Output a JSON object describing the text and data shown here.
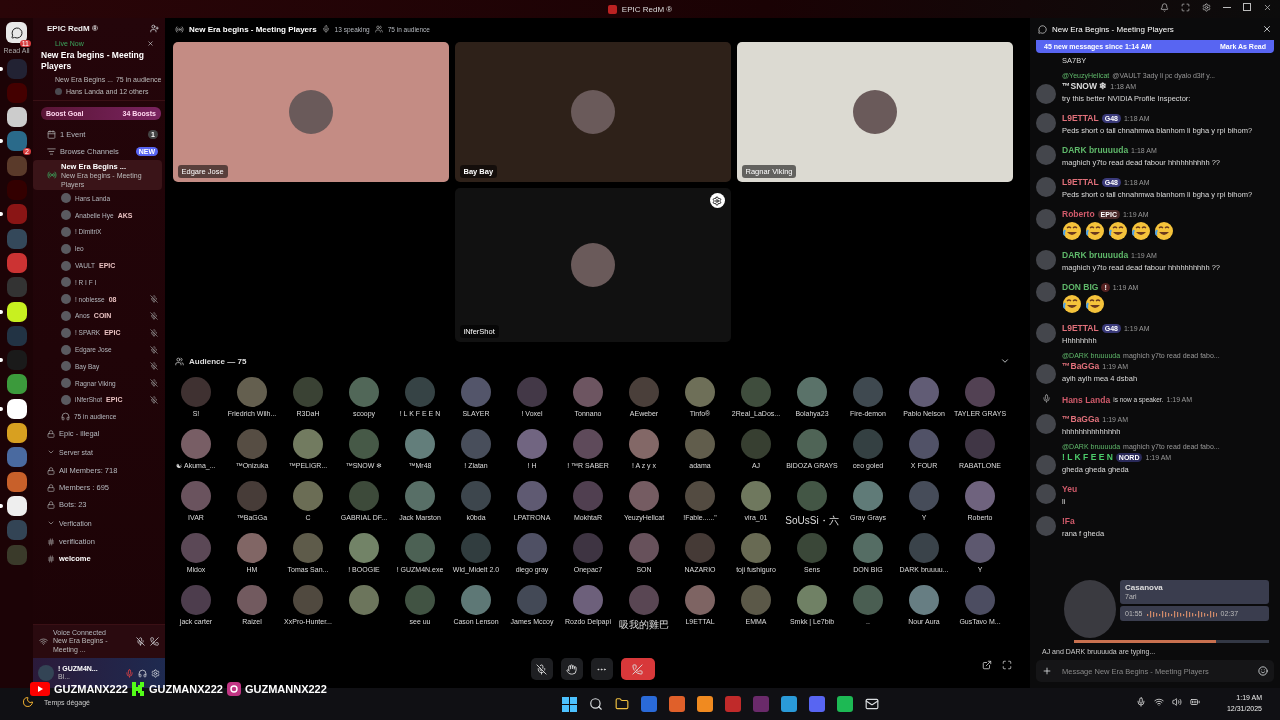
{
  "titlebar": {
    "title": "EPIC RedM ®"
  },
  "server_rail": {
    "read_all": "Read All",
    "badge": "11",
    "servers": [
      {
        "unread": true
      },
      {
        "unread": false
      },
      {
        "unread": false
      },
      {
        "unread": true,
        "badge": "2"
      },
      {
        "unread": false
      },
      {
        "unread": false
      },
      {
        "unread": true
      },
      {
        "unread": false
      },
      {
        "unread": false
      },
      {
        "unread": false
      },
      {
        "unread": true
      },
      {
        "unread": false
      },
      {
        "unread": true
      },
      {
        "unread": false
      },
      {
        "unread": true
      },
      {
        "unread": false
      },
      {
        "unread": false
      },
      {
        "unread": false
      },
      {
        "unread": true
      },
      {
        "unread": false
      },
      {
        "unread": false
      }
    ]
  },
  "sidebar": {
    "server_name": "EPIC RedM ®",
    "live": {
      "label": "Live Now",
      "title": "New Era begins - Meeting Players",
      "channel": "New Era Begins ...",
      "audience": "75 in audience",
      "listeners": "Hans Landa and 12 others"
    },
    "boost": {
      "label": "Boost Goal",
      "count": "34 Boosts"
    },
    "event": {
      "label": "1 Event",
      "count": "1"
    },
    "browse": {
      "label": "Browse Channels",
      "badge": "NEW"
    },
    "stage_channel": {
      "name": "New Era Begins ...",
      "subtitle": "New Era begins - Meeting Players",
      "selected": true
    },
    "speakers": [
      {
        "name": "Hans Landa",
        "muted": false
      },
      {
        "name": "Anabelle Hye",
        "tag": "AKS",
        "muted": false
      },
      {
        "name": "! DimitriX",
        "muted": false
      },
      {
        "name": "leo",
        "muted": false
      },
      {
        "name": "VAULT",
        "tag": "EPIC",
        "muted": false
      },
      {
        "name": "! R I F I",
        "muted": false
      },
      {
        "name": "! noblesse",
        "tag": "08",
        "muted": true
      },
      {
        "name": "Anos",
        "tag": "COIN",
        "muted": true
      },
      {
        "name": "! SPARK",
        "tag": "EPIC",
        "muted": true
      },
      {
        "name": "Edgare Jose",
        "muted": true
      },
      {
        "name": "Bay Bay",
        "muted": true
      },
      {
        "name": "Ragnar Viking",
        "muted": true
      },
      {
        "name": "iNferShot",
        "tag": "EPIC",
        "muted": true
      }
    ],
    "audience": "75 in audience",
    "channels": [
      {
        "kind": "locked",
        "name": "Epic - illegal"
      },
      {
        "kind": "category",
        "name": "Server stat"
      },
      {
        "kind": "locked",
        "name": "All Members: 718"
      },
      {
        "kind": "locked",
        "name": "Members : 695"
      },
      {
        "kind": "locked",
        "name": "Bots: 23"
      },
      {
        "kind": "category",
        "name": "Verfication"
      },
      {
        "kind": "text",
        "name": "verification",
        "selected": false
      },
      {
        "kind": "text",
        "name": "welcome",
        "selected": true
      }
    ],
    "voice": {
      "status": "Voice Connected",
      "channel": "New Era Begins - Meeting ..."
    },
    "user": {
      "name": "! GUZM4N...",
      "status": "Bl..."
    }
  },
  "stage": {
    "title": "New Era begins - Meeting Players",
    "speaking": "13 speaking",
    "audience": "75 in audience",
    "tiles": [
      {
        "name": "Edgare Jose",
        "color": "#c48c84"
      },
      {
        "name": "Bay Bay",
        "color": "#2e2119"
      },
      {
        "name": "Ragnar Viking",
        "color": "#dcdad2"
      },
      {
        "name": "iNferShot",
        "color": "#111111",
        "settings": true
      }
    ],
    "audience_title": "Audience — 75",
    "members": [
      {
        "name": "S!"
      },
      {
        "name": "Friedrich Wilh..."
      },
      {
        "name": "R3DaH"
      },
      {
        "name": "scoopy"
      },
      {
        "name": "! L K F E E N"
      },
      {
        "name": "SLAYER"
      },
      {
        "name": "! Voxel"
      },
      {
        "name": "Tonnano"
      },
      {
        "name": "AEweber"
      },
      {
        "name": "Tinfo®"
      },
      {
        "name": "2Real_LaDos..."
      },
      {
        "name": "Bolahya23"
      },
      {
        "name": "Fire-demon"
      },
      {
        "name": "Pablo Nelson"
      },
      {
        "name": "TAYLER GRAYS"
      },
      {
        "name": "☯ Akuma_..."
      },
      {
        "name": "™Onizuka"
      },
      {
        "name": "™PELIGR..."
      },
      {
        "name": "™SNOW ❄"
      },
      {
        "name": "™Mr48"
      },
      {
        "name": "! Zlatan"
      },
      {
        "name": "! H"
      },
      {
        "name": "! ™R SABER"
      },
      {
        "name": "! A z y x"
      },
      {
        "name": "adama"
      },
      {
        "name": "AJ"
      },
      {
        "name": "BIDOZA GRAYS"
      },
      {
        "name": "ceo goled"
      },
      {
        "name": "X FOUR"
      },
      {
        "name": "RABATLONE"
      },
      {
        "name": "IVAR"
      },
      {
        "name": "™BaGGa"
      },
      {
        "name": "C"
      },
      {
        "name": "GABRIAL DF..."
      },
      {
        "name": "Jack Marston"
      },
      {
        "name": "k0bda"
      },
      {
        "name": "LPATRONA"
      },
      {
        "name": "MokhtaR"
      },
      {
        "name": "YeuzyHellcat"
      },
      {
        "name": "!Fable......\""
      },
      {
        "name": "vira_01"
      },
      {
        "name": "SoUsSi・六"
      },
      {
        "name": "Gray Grays"
      },
      {
        "name": "Y"
      },
      {
        "name": "Roberto"
      },
      {
        "name": "Midox"
      },
      {
        "name": "HM"
      },
      {
        "name": "Tomas San..."
      },
      {
        "name": "! BOOGIE"
      },
      {
        "name": "! GUZM4N.exe"
      },
      {
        "name": "Wld_Midelt 2.0"
      },
      {
        "name": "diego gray"
      },
      {
        "name": "Onepac7"
      },
      {
        "name": "SON"
      },
      {
        "name": "NAZARIO"
      },
      {
        "name": "toji fushiguro"
      },
      {
        "name": "Sens"
      },
      {
        "name": "DON BIG"
      },
      {
        "name": "DARK bruuuu..."
      },
      {
        "name": "Y"
      },
      {
        "name": "jack carter"
      },
      {
        "name": "Raizel"
      },
      {
        "name": "XxPro-Hunter..."
      },
      {
        "kind": "no-name"
      },
      {
        "name": "see uu"
      },
      {
        "name": "Cason Lenson"
      },
      {
        "name": "James Mccoy"
      },
      {
        "name": "Rozdo Delpapi"
      },
      {
        "name": "吸我的雞巴"
      },
      {
        "name": "L9ETTAL"
      },
      {
        "name": "EMMA"
      },
      {
        "name": "Smkk | Le7bib"
      },
      {
        "name": ".."
      },
      {
        "name": "Nour Aura"
      },
      {
        "name": "GusTavo M..."
      }
    ]
  },
  "chat": {
    "title": "New Era Begins - Meeting Players",
    "banner": "45 new messages since 1:14 AM",
    "mark_read": "Mark As Read",
    "messages": [
      {
        "kind": "continuation",
        "text": "SA7BY"
      },
      {
        "kind": "message",
        "reply": {
          "author": "@YeuzyHellcat",
          "text": "@VAULT 3ady li pc dyalo d3if y..."
        },
        "author": "™SNOW ❄",
        "color": "#dddddd",
        "time": "1:18 AM",
        "text": "try this better NVIDIA Profile Inspector:"
      },
      {
        "kind": "message",
        "author": "L9ETTAL",
        "tag": "G48",
        "color": "#e0707a",
        "time": "1:18 AM",
        "text": "Peds short o tall chnahmwa blanhom li bgha y rpi bihom?"
      },
      {
        "kind": "message",
        "author": "DARK  bruuuuda",
        "color": "#5fb86a",
        "time": "1:18 AM",
        "text": "maghich y7to read dead fabour hhhhhhhhhh ??"
      },
      {
        "kind": "message",
        "author": "L9ETTAL",
        "tag": "G48",
        "color": "#e0707a",
        "time": "1:18 AM",
        "text": "Peds short o tall chnahmwa blanhom li bgha y rpi bihom?"
      },
      {
        "kind": "message",
        "author": "Roberto",
        "tag": "EPIC",
        "color": "#d05a6a",
        "time": "1:19 AM",
        "emojis": [
          {
            "kind": "laughing"
          },
          {
            "kind": "laughing"
          },
          {
            "kind": "laughing"
          },
          {
            "kind": "laughing"
          },
          {
            "kind": "laughing"
          }
        ]
      },
      {
        "kind": "message",
        "author": "DARK  bruuuuda",
        "color": "#5fb86a",
        "time": "1:19 AM",
        "text": "maghich y7to read dead fabour hhhhhhhhhh ??"
      },
      {
        "kind": "message",
        "author": "DON BIG",
        "tag": "!",
        "color": "#5fb86a",
        "time": "1:19 AM",
        "emojis": [
          {
            "kind": "laughing"
          },
          {
            "kind": "laughing"
          }
        ]
      },
      {
        "kind": "message",
        "author": "L9ETTAL",
        "tag": "G48",
        "color": "#e0707a",
        "time": "1:19 AM",
        "text": "Hhhhhhhh"
      },
      {
        "kind": "message",
        "reply": {
          "author": "@DARK  bruuuuda",
          "text": "maghich y7to read dead fabo..."
        },
        "author": "™BaGGa",
        "color": "#e0707a",
        "time": "1:19 AM",
        "text": "ayih ayih mea 4  dsbah"
      },
      {
        "kind": "system",
        "author": "Hans Landa",
        "text": "is now a speaker.",
        "time": "1:19 AM"
      },
      {
        "kind": "message",
        "author": "™BaGGa",
        "color": "#e0707a",
        "time": "1:19 AM",
        "text": "hhhhhhhhhhhhhh"
      },
      {
        "kind": "message",
        "reply": {
          "author": "@DARK  bruuuuda",
          "text": "maghich y7to read dead fabo..."
        },
        "author": "! L K F E E N",
        "tag": "NORD",
        "color": "#4ccb6a",
        "time": "1:19 AM",
        "text": "gheda gheda gheda"
      },
      {
        "kind": "message",
        "author": "Yeu",
        "color": "#d05a6a",
        "text": "li"
      },
      {
        "kind": "message",
        "author": "!Fa",
        "color": "#d05a6a",
        "text": "rana f gheda"
      }
    ],
    "player": {
      "title": "Casanova",
      "artist": "7ari",
      "elapsed": "01:55",
      "total": "02:37",
      "level": 0.73
    },
    "typing": "AJ and DARK bruuuuda are typing...",
    "placeholder": "Message New Era Begins - Meeting Players"
  },
  "overlay": {
    "weather": "Temps dégagé",
    "socials": [
      {
        "kind": "youtube",
        "handle": "GUZMANX222"
      },
      {
        "kind": "kick",
        "handle": "GUZMANX222"
      },
      {
        "kind": "instagram",
        "handle": "GUZMANNX222"
      }
    ]
  },
  "taskbar": {
    "time": "1:19 AM",
    "date": "12/31/2025"
  }
}
